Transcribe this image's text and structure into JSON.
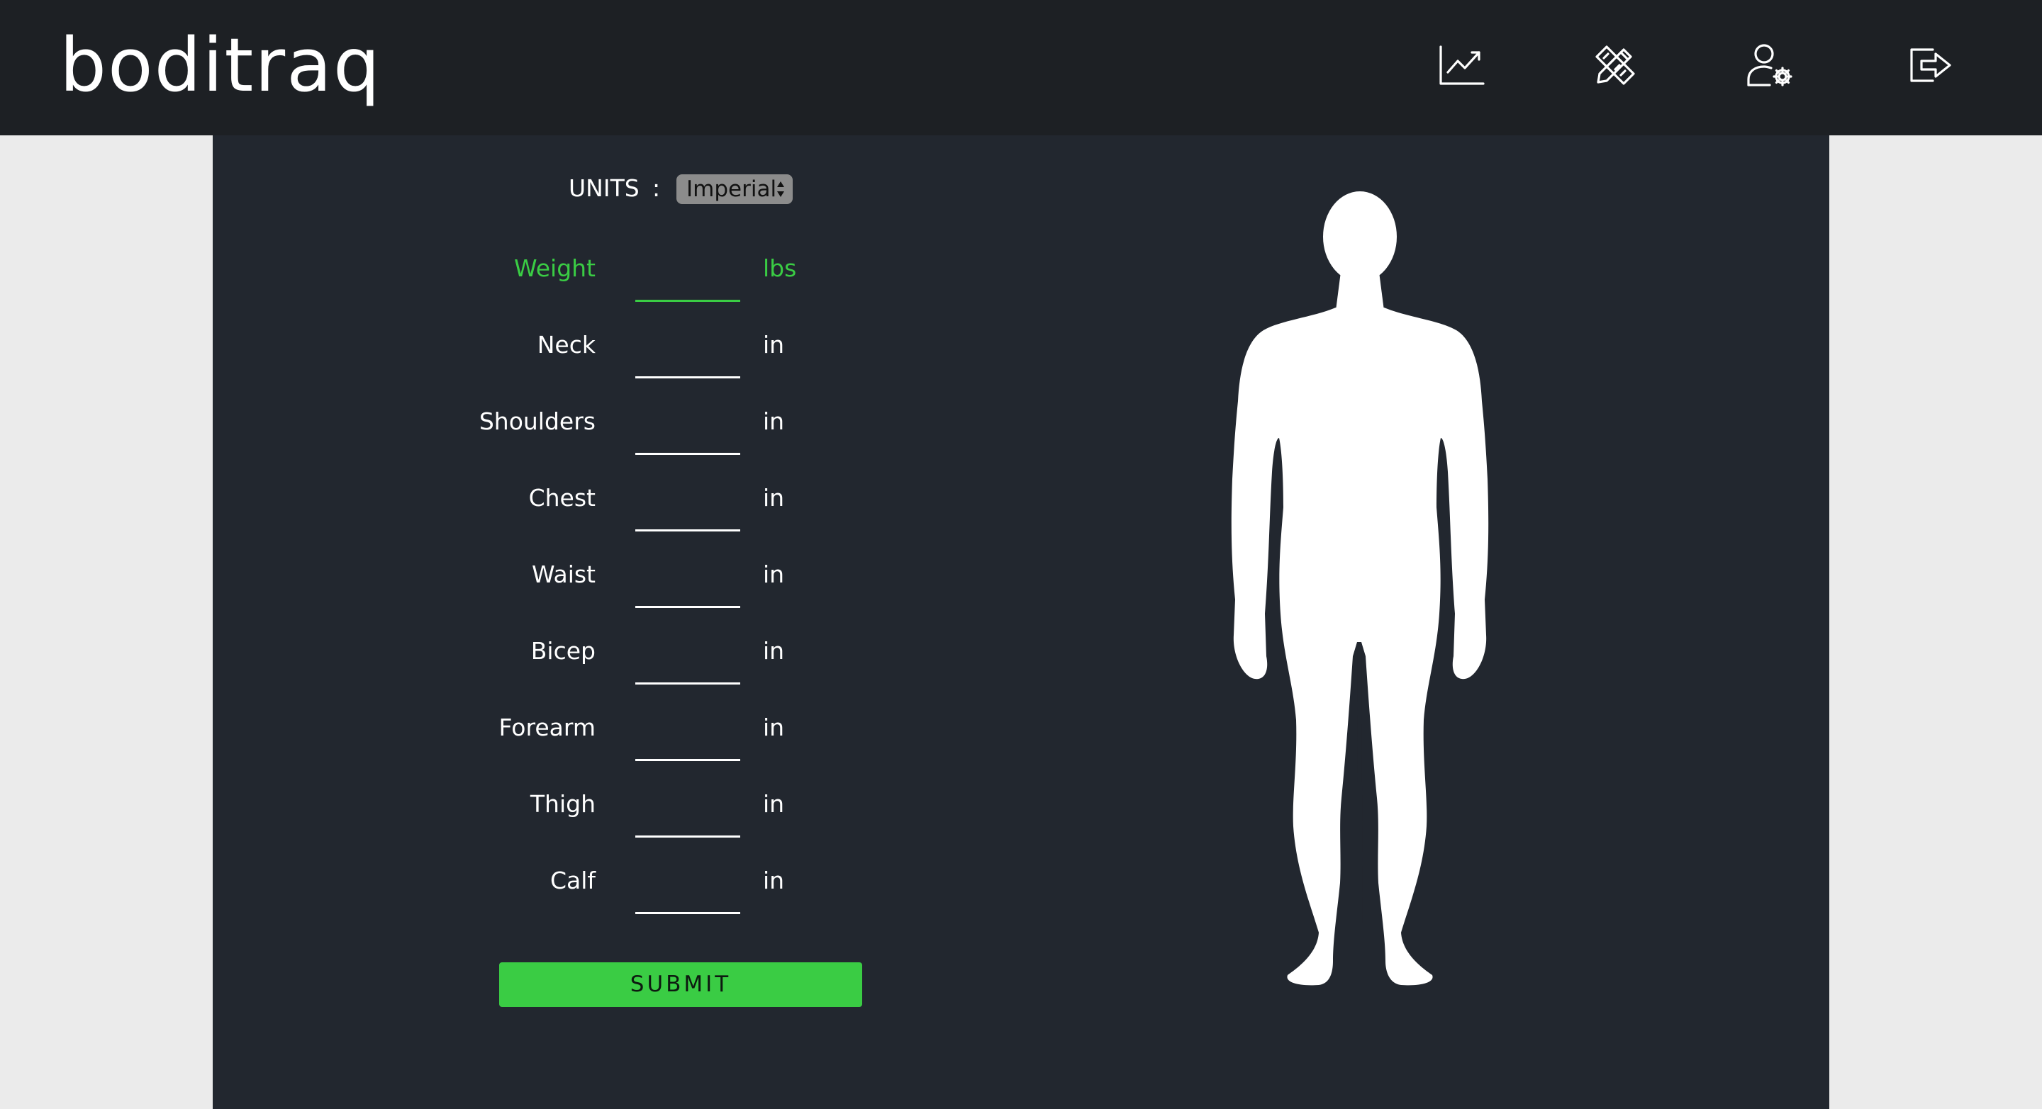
{
  "app": {
    "logo_text": "boditraq"
  },
  "nav": {
    "icons": [
      "chart-line-icon",
      "pencil-ruler-icon",
      "user-settings-icon",
      "logout-icon"
    ]
  },
  "form": {
    "units_label": "UNITS",
    "units_separator": ":",
    "units_value": "Imperial",
    "fields": [
      {
        "label": "Weight",
        "unit": "lbs",
        "value": ""
      },
      {
        "label": "Neck",
        "unit": "in",
        "value": ""
      },
      {
        "label": "Shoulders",
        "unit": "in",
        "value": ""
      },
      {
        "label": "Chest",
        "unit": "in",
        "value": ""
      },
      {
        "label": "Waist",
        "unit": "in",
        "value": ""
      },
      {
        "label": "Bicep",
        "unit": "in",
        "value": ""
      },
      {
        "label": "Forearm",
        "unit": "in",
        "value": ""
      },
      {
        "label": "Thigh",
        "unit": "in",
        "value": ""
      },
      {
        "label": "Calf",
        "unit": "in",
        "value": ""
      }
    ],
    "submit_label": "SUBMIT"
  },
  "colors": {
    "accent": "#3acc44",
    "header_bg": "#1d2024",
    "panel_bg": "#22272f",
    "page_bg": "#ebebeb"
  }
}
